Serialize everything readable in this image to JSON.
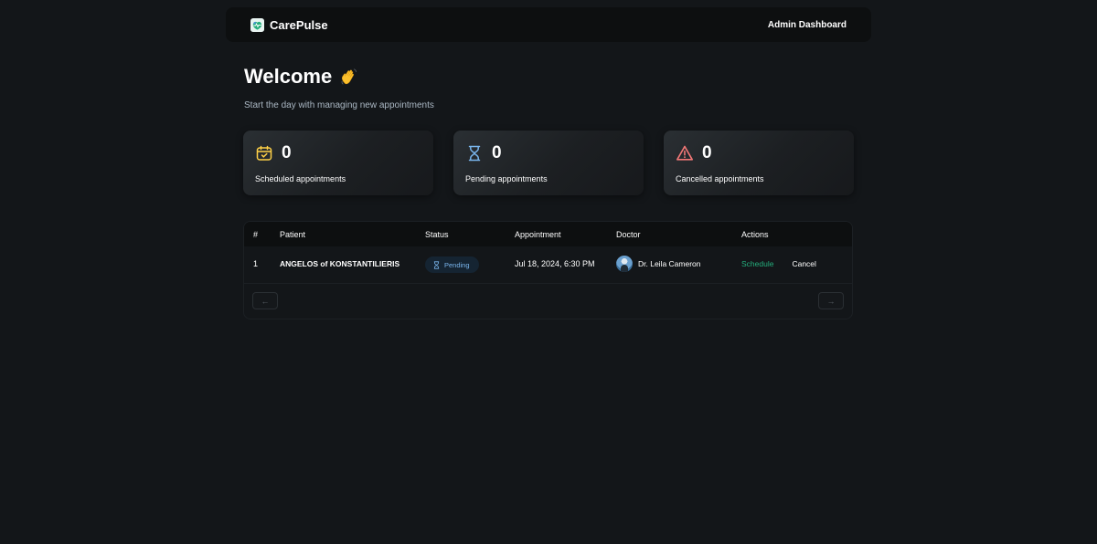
{
  "header": {
    "brand_name": "CarePulse",
    "title": "Admin Dashboard"
  },
  "welcome": {
    "title": "Welcome",
    "emoji_icon": "waving-hand-icon",
    "subtitle": "Start the day with managing new appointments"
  },
  "stats": [
    {
      "icon": "calendar-icon",
      "color": "#ffd147",
      "count": "0",
      "label": "Scheduled appointments"
    },
    {
      "icon": "hourglass-icon",
      "color": "#79b5ec",
      "count": "0",
      "label": "Pending appointments"
    },
    {
      "icon": "warning-icon",
      "color": "#f37877",
      "count": "0",
      "label": "Cancelled appointments"
    }
  ],
  "table": {
    "headers": [
      "#",
      "Patient",
      "Status",
      "Appointment",
      "Doctor",
      "Actions"
    ],
    "rows": [
      {
        "num": "1",
        "patient": "ANGELOS of KONSTANTILIERIS",
        "status": "Pending",
        "appointment": "Jul 18, 2024, 6:30 PM",
        "doctor": "Dr. Leila Cameron",
        "actions": {
          "schedule": "Schedule",
          "cancel": "Cancel"
        }
      }
    ],
    "pager": {
      "prev": "←",
      "next": "→"
    }
  },
  "colors": {
    "background": "#131619",
    "header_bg": "#0d0f10",
    "accent_green": "#24ae7c",
    "pending_blue": "#79b5ec"
  }
}
